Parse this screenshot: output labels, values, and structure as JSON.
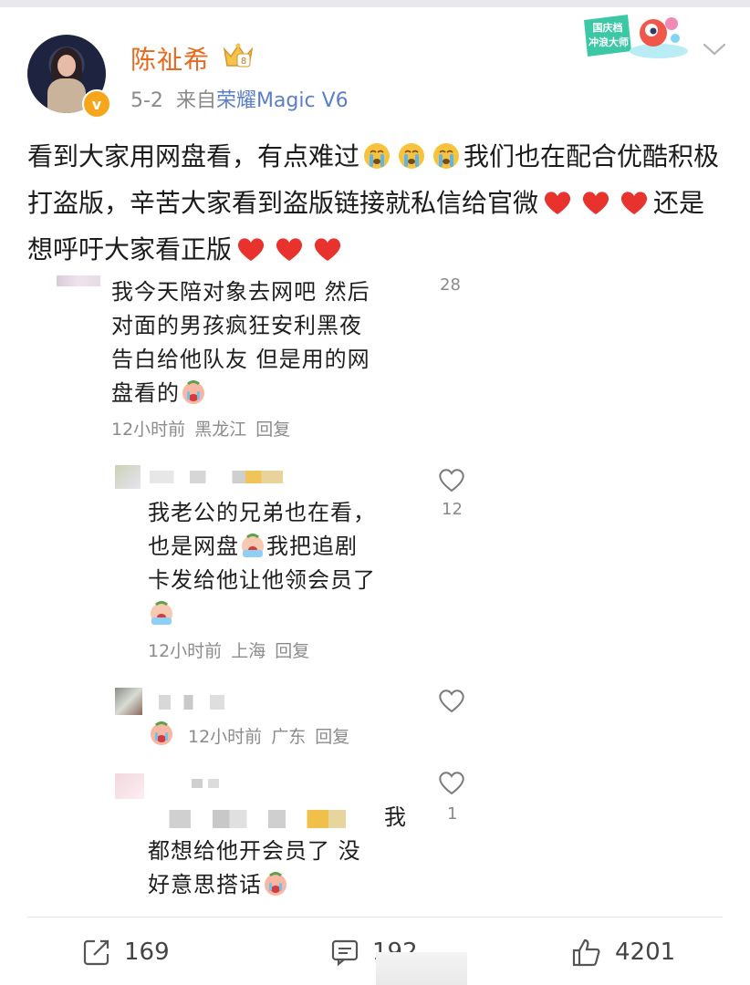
{
  "header": {
    "username": "陈祉希",
    "date": "5-2",
    "source_prefix": "来自",
    "device": "荣耀Magic V6",
    "badge_text_1": "国庆档",
    "badge_text_2": "冲浪大师",
    "verified_mark": "v"
  },
  "post": {
    "segments": [
      "看到大家用网盘看，有点难过",
      "我们也在配合优酷积极打盗版，辛苦大家看到盗版链接就私信给官微",
      "还是想呼吁大家看正版"
    ]
  },
  "screenshot": {
    "comments": [
      {
        "lines": [
          "我今天陪对象去网吧 然后",
          "对面的男孩疯狂安利黑夜",
          "告白给他队友 但是用的网",
          "盘看的"
        ],
        "time": "12小时前",
        "location": "黑龙江",
        "reply": "回复",
        "likes": "28"
      },
      {
        "lines": [
          "我老公的兄弟也在看，",
          "也是网盘",
          "我把追剧",
          "卡发给他让他领会员了"
        ],
        "time": "12小时前",
        "location": "上海",
        "reply": "回复",
        "likes": "12"
      },
      {
        "lines": [],
        "time": "12小时前",
        "location": "广东",
        "reply": "回复",
        "likes": ""
      },
      {
        "lines": [
          "我",
          "都想给他开会员了 没",
          "好意思搭话"
        ],
        "likes": "1"
      }
    ]
  },
  "actions": {
    "repost_count": "169",
    "comment_count": "192",
    "like_count": "4201"
  },
  "colors": {
    "username": "#e86a1e",
    "device_link": "#5b7fc7",
    "heart": "#e8322e",
    "verified": "#f7a61c"
  }
}
